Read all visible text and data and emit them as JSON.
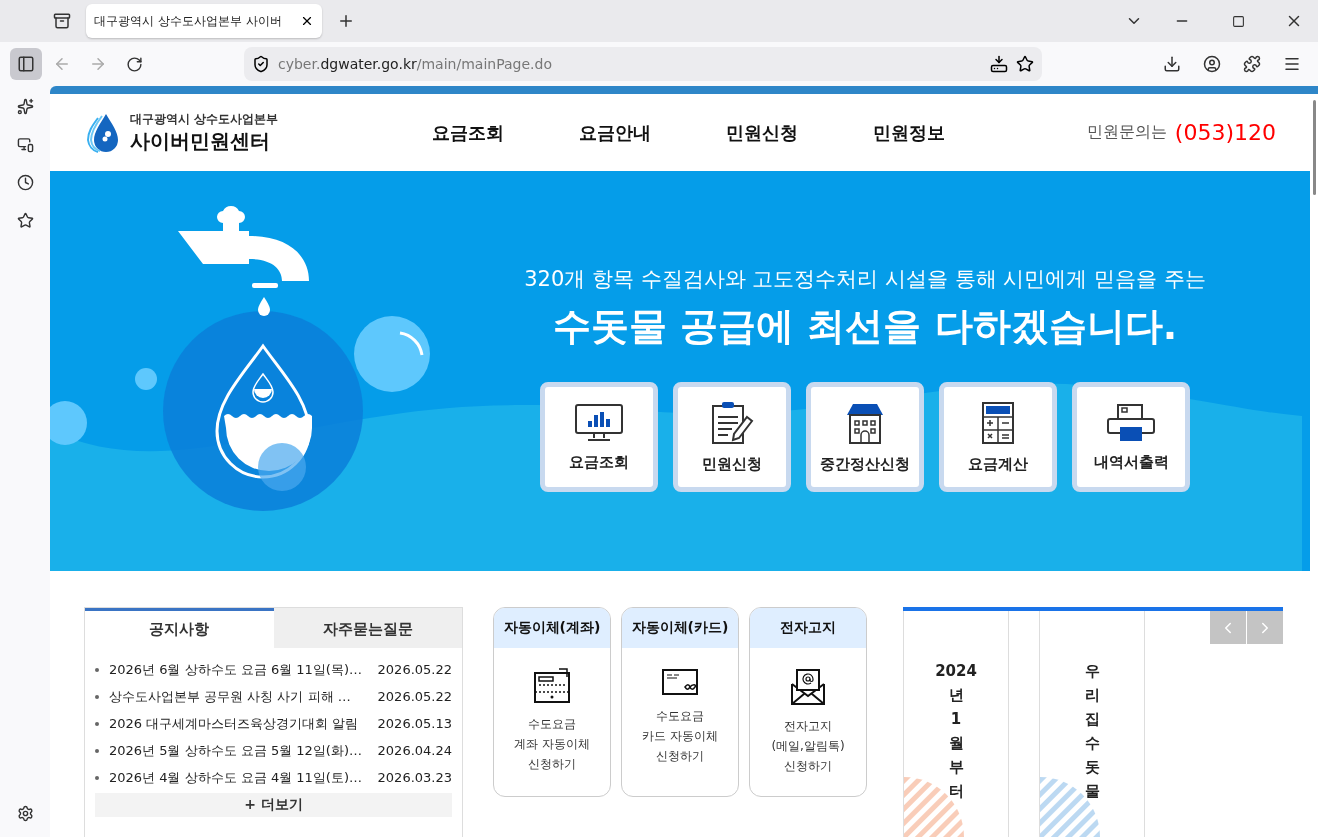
{
  "browser": {
    "tab_title": "대구광역시 상수도사업본부 사이버",
    "url_host": "cyber.",
    "url_domain": "dgwater.go.kr",
    "url_path": "/main/mainPage.do"
  },
  "site": {
    "org": "대구광역시 상수도사업본부",
    "name": "사이버민원센터"
  },
  "nav": [
    "요금조회",
    "요금안내",
    "민원신청",
    "민원정보"
  ],
  "contact": {
    "label": "민원문의는",
    "phone": "(053)120"
  },
  "hero": {
    "subtitle": "320개 항목 수질검사와 고도정수처리 시설을 통해 시민에게 믿음을 주는",
    "title": "수돗물 공급에 최선을 다하겠습니다."
  },
  "quick_menu": [
    {
      "label": "요금조회",
      "kind": "monitor"
    },
    {
      "label": "민원신청",
      "kind": "clipboard"
    },
    {
      "label": "중간정산신청",
      "kind": "building"
    },
    {
      "label": "요금계산",
      "kind": "calculator"
    },
    {
      "label": "내역서출력",
      "kind": "printer"
    }
  ],
  "notice_tabs": [
    {
      "label": "공지사항",
      "selected": true
    },
    {
      "label": "자주묻는질문",
      "selected": false
    }
  ],
  "notices": [
    {
      "title": "2026년 6월 상하수도 요금 6월 11일(목)…",
      "date": "2026.05.22"
    },
    {
      "title": "상수도사업본부 공무원 사칭 사기 피해 …",
      "date": "2026.05.22"
    },
    {
      "title": "2026 대구세계마스터즈육상경기대회 알림",
      "date": "2026.05.13"
    },
    {
      "title": "2026년 5월 상하수도 요금 5월 12일(화)…",
      "date": "2026.04.24"
    },
    {
      "title": "2026년 4월 상하수도 요금 4월 11일(토)…",
      "date": "2026.03.23"
    }
  ],
  "more": "+ 더보기",
  "services": [
    {
      "title": "자동이체(계좌)",
      "kind": "register",
      "lines": [
        "수도요금",
        "계좌 자동이체",
        "신청하기"
      ]
    },
    {
      "title": "자동이체(카드)",
      "kind": "card",
      "lines": [
        "수도요금",
        "카드 자동이체",
        "신청하기"
      ]
    },
    {
      "title": "전자고지",
      "kind": "mail",
      "lines": [
        "전자고지",
        "(메일,알림톡)",
        "신청하기"
      ]
    }
  ],
  "banners": [
    {
      "text": "2024년1월부터",
      "color": "#f9cdb9"
    },
    {
      "text": "우리집수돗물",
      "color": "#bcd9f2"
    }
  ]
}
